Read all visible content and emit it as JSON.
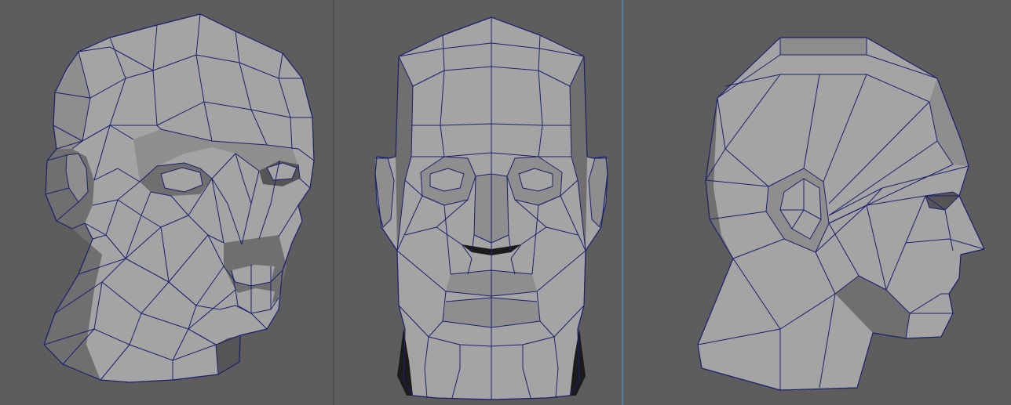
{
  "viewports": [
    {
      "name": "perspective-view",
      "active": false
    },
    {
      "name": "front-view",
      "active": false
    },
    {
      "name": "side-view",
      "active": true
    }
  ],
  "colors": {
    "viewport_bg": "#5d5d5d",
    "mesh_face": "#a4a4a4",
    "wireframe": "#1c1f6e",
    "active_divider": "#5b7a9a"
  }
}
